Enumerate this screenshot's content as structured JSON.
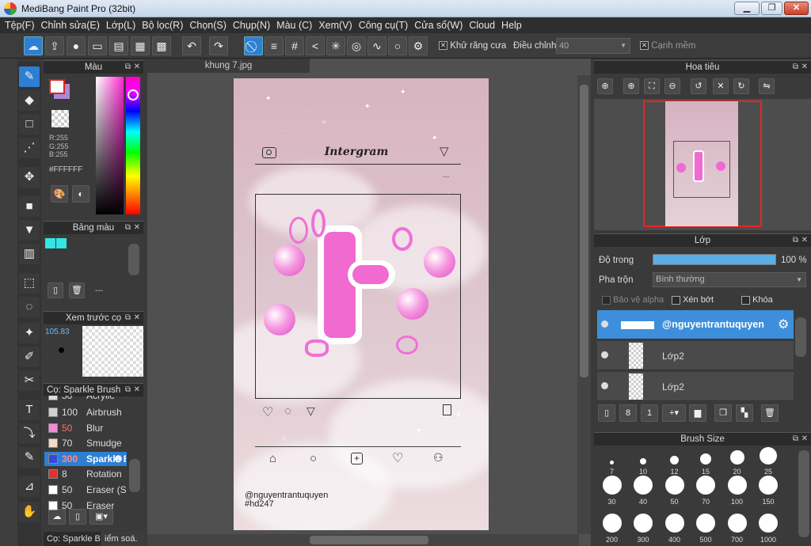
{
  "window": {
    "title": "MediBang Paint Pro (32bit)",
    "min": "▁",
    "max": "❐",
    "close": "✕"
  },
  "menu": [
    "Tệp(F)",
    "Chỉnh sửa(E)",
    "Lớp(L)",
    "Bộ lọc(R)",
    "Chọn(S)",
    "Chụp(N)",
    "Màu (C)",
    "Xem(V)",
    "Công cụ(T)",
    "Cửa sổ(W)",
    "Cloud",
    "Help"
  ],
  "toolbar": {
    "antialias_label": "Khử răng cưa",
    "correction_label": "Điều chỉnh",
    "correction_value": "40",
    "soft_edge_label": "Cạnh mềm",
    "check_mark": "✕"
  },
  "color_panel": {
    "title": "Màu",
    "r": "R:255",
    "g": "G:255",
    "b": "B:255",
    "hex": "#FFFFFF"
  },
  "palette_panel": {
    "title": "Bảng màu",
    "value": "---",
    "swatches": [
      "#33e5e5",
      "#33e5e5"
    ]
  },
  "brush_preview": {
    "title": "Xem trước cọ",
    "size": "105.83"
  },
  "brush_panel": {
    "title": "Cọ: Sparkle Brush",
    "top_partial": "Acrylic",
    "items": [
      {
        "n": "100",
        "name": "Airbrush",
        "color": "#cfcfcf"
      },
      {
        "n": "50",
        "name": "Blur",
        "color": "#f28ad8",
        "ncolor": "#ff6e6e"
      },
      {
        "n": "70",
        "name": "Smudge",
        "color": "#f2ddc4"
      },
      {
        "n": "300",
        "name": "Sparkle Brush",
        "color": "#3348e0",
        "selected": true
      },
      {
        "n": "8",
        "name": "Rotation",
        "color": "#e03030"
      },
      {
        "n": "50",
        "name": "Eraser (Soft)",
        "color": "#ffffff"
      },
      {
        "n": "50",
        "name": "Eraser",
        "color": "#ffffff"
      }
    ],
    "footer_tab1": "Cọ: Sparkle B...",
    "footer_tab2": "iểm soá."
  },
  "document": {
    "tab": "khung 7.jpg"
  },
  "artwork": {
    "header": "Intergram",
    "dots": "...",
    "handle": "@nguyentrantuquyen",
    "hashtag": "#hd247"
  },
  "navigator": {
    "title": "Hoa tiêu"
  },
  "layers_panel": {
    "title": "Lớp",
    "opacity_label": "Độ trong",
    "opacity_value": "100 %",
    "blend_label": "Pha trộn",
    "blend_value": "Bình thường",
    "protect_alpha": "Bảo vệ alpha",
    "clipping": "Xén bớt",
    "lock": "Khóa",
    "layers": [
      {
        "name": "@nguyentrantuquyen",
        "selected": true
      },
      {
        "name": "Lớp2"
      },
      {
        "name": "Lớp2"
      }
    ]
  },
  "brush_size": {
    "title": "Brush Size",
    "row1": [
      "7",
      "10",
      "12",
      "15",
      "20",
      "25"
    ],
    "row2": [
      "30",
      "40",
      "50",
      "70",
      "100",
      "150"
    ],
    "row3": [
      "200",
      "300",
      "400",
      "500",
      "700",
      "1000"
    ]
  }
}
